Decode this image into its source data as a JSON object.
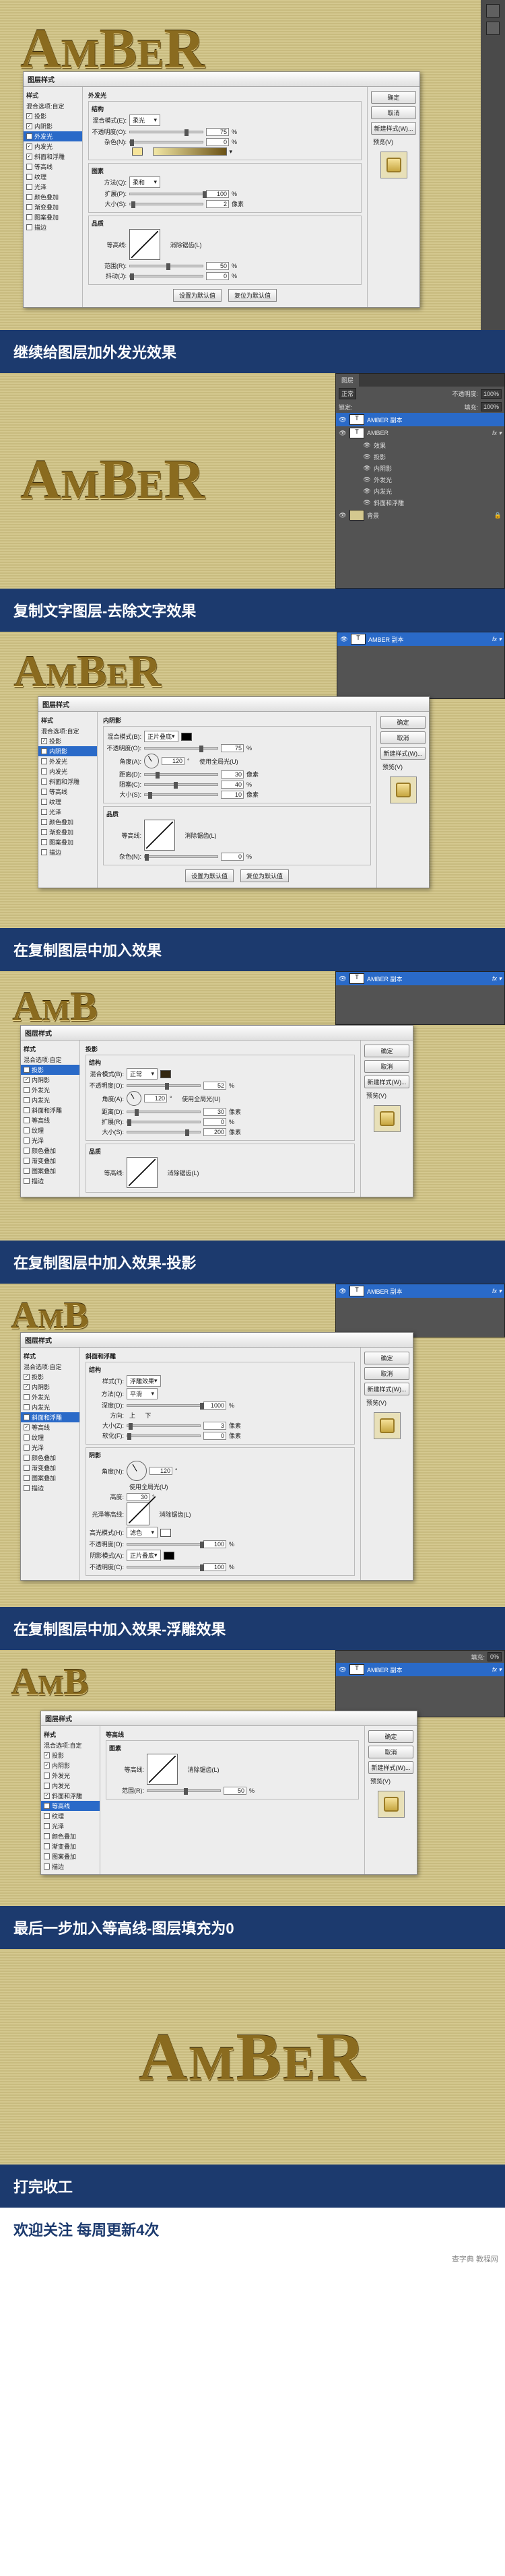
{
  "steps": [
    {
      "caption": "继续给图层加外发光效果"
    },
    {
      "caption": "复制文字图层-去除文字效果"
    },
    {
      "caption": "在复制图层中加入效果"
    },
    {
      "caption": "在复制图层中加入效果-投影"
    },
    {
      "caption": "在复制图层中加入效果-浮雕效果"
    },
    {
      "caption": "最后一步加入等高线-图层填充为0"
    },
    {
      "caption": "打完收工"
    }
  ],
  "closing": "欢迎关注 每周更新4次",
  "word": "AMBER",
  "dialog_title": "图层样式",
  "styles_header": "样式",
  "blend_opts": "混合选项:自定",
  "style_items": [
    "投影",
    "内阴影",
    "外发光",
    "内发光",
    "斜面和浮雕",
    "等高线",
    "纹理",
    "光泽",
    "颜色叠加",
    "渐变叠加",
    "图案叠加",
    "描边"
  ],
  "btns": {
    "ok": "确定",
    "cancel": "取消",
    "new": "新建样式(W)...",
    "preview": "预览(V)"
  },
  "d1": {
    "title": "外发光",
    "struct": "结构",
    "blend_mode": "混合模式(E):",
    "blend_val": "柔光",
    "opacity": "不透明度(O):",
    "opacity_val": "75",
    "noise": "杂色(N):",
    "noise_val": "0",
    "elem": "图素",
    "method": "方法(Q):",
    "method_val": "柔和",
    "spread": "扩展(P):",
    "spread_val": "100",
    "size": "大小(S):",
    "size_val": "2",
    "quality": "品质",
    "contour": "等高线:",
    "anti": "消除锯齿(L)",
    "range": "范围(R):",
    "range_val": "50",
    "jitter": "抖动(J):",
    "jitter_val": "0",
    "default_btn": "设置为默认值",
    "reset_btn": "复位为默认值",
    "pct": "%",
    "px": "像素",
    "selected": "外发光",
    "checked": [
      "投影",
      "内阴影",
      "外发光",
      "内发光",
      "斜面和浮雕"
    ]
  },
  "d3": {
    "title": "内阴影",
    "blend_mode": "混合模式(B):",
    "blend_val": "正片叠底",
    "opacity": "不透明度(O):",
    "opacity_val": "75",
    "angle": "角度(A):",
    "angle_val": "120",
    "global": "使用全局光(U)",
    "distance": "距离(D):",
    "distance_val": "30",
    "choke": "阻塞(C):",
    "choke_val": "40",
    "size": "大小(S):",
    "size_val": "10",
    "quality": "品质",
    "contour": "等高线:",
    "anti": "消除锯齿(L)",
    "noise": "杂色(N):",
    "noise_val": "0",
    "default_btn": "设置为默认值",
    "reset_btn": "复位为默认值",
    "selected": "内阴影",
    "checked": [
      "投影",
      "内阴影"
    ]
  },
  "d4": {
    "title": "投影",
    "blend_mode": "混合模式(B):",
    "blend_val": "正常",
    "opacity": "不透明度(O):",
    "opacity_val": "52",
    "angle": "角度(A):",
    "angle_val": "120",
    "global": "使用全局光(U)",
    "distance": "距离(D):",
    "distance_val": "30",
    "spread": "扩展(R):",
    "spread_val": "0",
    "size": "大小(S):",
    "size_val": "200",
    "quality": "品质",
    "contour": "等高线:",
    "anti": "消除锯齿(L)",
    "selected": "投影",
    "checked": [
      "投影",
      "内阴影"
    ]
  },
  "d5": {
    "title": "斜面和浮雕",
    "struct": "结构",
    "style_lbl": "样式(T):",
    "style_val": "浮雕效果",
    "method": "方法(Q):",
    "method_val": "平滑",
    "depth": "深度(D):",
    "depth_val": "1000",
    "dir": "方向:",
    "up": "上",
    "down": "下",
    "size": "大小(Z):",
    "size_val": "3",
    "soften": "软化(F):",
    "soften_val": "0",
    "shade": "阴影",
    "angle": "角度(N):",
    "angle_val": "120",
    "global": "使用全局光(U)",
    "alt": "高度:",
    "alt_val": "30",
    "gloss": "光泽等高线:",
    "anti": "消除锯齿(L)",
    "hmode": "高光模式(H):",
    "hmode_val": "滤色",
    "hopacity": "不透明度(O):",
    "hopacity_val": "100",
    "smode": "阴影模式(A):",
    "smode_val": "正片叠底",
    "sopacity": "不透明度(C):",
    "sopacity_val": "100",
    "selected": "斜面和浮雕",
    "checked": [
      "投影",
      "内阴影",
      "斜面和浮雕",
      "等高线"
    ]
  },
  "d6": {
    "title": "等高线",
    "elem": "图素",
    "contour": "等高线:",
    "anti": "消除锯齿(L)",
    "range": "范围(R):",
    "range_val": "50",
    "selected": "等高线",
    "checked": [
      "投影",
      "内阴影",
      "斜面和浮雕",
      "等高线"
    ]
  },
  "layers": {
    "tab": "图层",
    "mode": "正常",
    "opacity_lbl": "不透明度:",
    "opacity": "100%",
    "lock": "锁定:",
    "fill_lbl": "填充:",
    "fill": "100%",
    "fill0": "0%",
    "copy": "AMBER 副本",
    "orig": "AMBER",
    "fx": "效果",
    "fx_items": [
      "投影",
      "内阴影",
      "外发光",
      "内发光",
      "斜面和浮雕"
    ],
    "bg": "背景"
  },
  "footer": "查字典 教程网"
}
